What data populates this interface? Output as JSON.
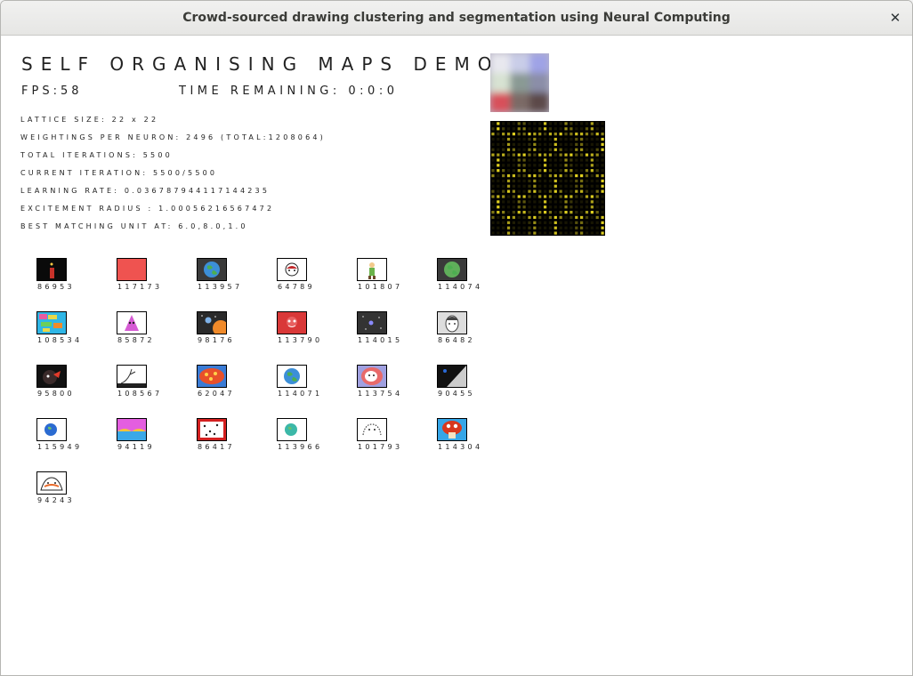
{
  "window": {
    "title": "Crowd-sourced drawing clustering and segmentation using Neural Computing"
  },
  "header": {
    "heading": "SELF ORGANISING MAPS DEMO",
    "fps": "FPS:58",
    "time_remaining": "TIME REMAINING: 0:0:0"
  },
  "stats": [
    "LATTICE SIZE: 22 x 22",
    "WEIGHTINGS PER NEURON: 2496 (TOTAL:1208064)",
    "TOTAL ITERATIONS: 5500",
    "CURRENT ITERATION: 5500/5500",
    "LEARNING RATE: 0.036787944117144235",
    "EXCITEMENT RADIUS : 1.00056216567472",
    "BEST MATCHING UNIT AT: 6.0,8.0,1.0"
  ],
  "colors": {
    "umatrix_line": "#e0d020",
    "umatrix_bg": "#000000"
  },
  "drawings": [
    {
      "id": "86953",
      "icon": "dark-scene",
      "bg": "#0a0a0a",
      "fg": "#c8322a"
    },
    {
      "id": "117173",
      "icon": "solid-red",
      "bg": "#ef5350",
      "fg": "#ef5350"
    },
    {
      "id": "113957",
      "icon": "earth-globe",
      "bg": "#3a3a3a",
      "fg": "#3c8fd8"
    },
    {
      "id": "64789",
      "icon": "cartoon-face",
      "bg": "#ffffff",
      "fg": "#c0282a"
    },
    {
      "id": "101807",
      "icon": "green-figure",
      "bg": "#ffffff",
      "fg": "#6ab34a"
    },
    {
      "id": "114074",
      "icon": "earth-globe",
      "bg": "#3a3a3a",
      "fg": "#5fae5a"
    },
    {
      "id": "108534",
      "icon": "colorful-pattern",
      "bg": "#2fb6e6",
      "fg": "#e8d84a"
    },
    {
      "id": "85872",
      "icon": "pink-creature",
      "bg": "#ffffff",
      "fg": "#d65bd4"
    },
    {
      "id": "98176",
      "icon": "planets",
      "bg": "#2a2a2a",
      "fg": "#f08a2a"
    },
    {
      "id": "113790",
      "icon": "red-face",
      "bg": "#d93838",
      "fg": "#ffffff"
    },
    {
      "id": "114015",
      "icon": "space",
      "bg": "#333333",
      "fg": "#8a8aff"
    },
    {
      "id": "86482",
      "icon": "portrait",
      "bg": "#dddddd",
      "fg": "#444444"
    },
    {
      "id": "95800",
      "icon": "dark-character",
      "bg": "#111111",
      "fg": "#e23a2a"
    },
    {
      "id": "108567",
      "icon": "sketch",
      "bg": "#ffffff",
      "fg": "#333333"
    },
    {
      "id": "62047",
      "icon": "mushroom-pattern",
      "bg": "#3a7bd5",
      "fg": "#e8502a"
    },
    {
      "id": "114071",
      "icon": "earth-globe",
      "bg": "#ffffff",
      "fg": "#3c8fd8"
    },
    {
      "id": "113754",
      "icon": "colorful-blob",
      "bg": "#a0a0e0",
      "fg": "#e86a6a"
    },
    {
      "id": "90455",
      "icon": "diagonal-split",
      "bg": "#111111",
      "fg": "#cccccc"
    },
    {
      "id": "115949",
      "icon": "earth-small",
      "bg": "#ffffff",
      "fg": "#2b6bd1"
    },
    {
      "id": "94119",
      "icon": "landscape",
      "bg": "#e45ee0",
      "fg": "#3aa8e8"
    },
    {
      "id": "86417",
      "icon": "speckled-red",
      "bg": "#d42020",
      "fg": "#ffffff"
    },
    {
      "id": "113966",
      "icon": "earth-small",
      "bg": "#ffffff",
      "fg": "#3cb8a8"
    },
    {
      "id": "101793",
      "icon": "outline-sketch",
      "bg": "#ffffff",
      "fg": "#222222"
    },
    {
      "id": "114304",
      "icon": "mushroom",
      "bg": "#35a6e8",
      "fg": "#d8381e"
    },
    {
      "id": "94243",
      "icon": "character-face",
      "bg": "#ffffff",
      "fg": "#e86a2a"
    }
  ]
}
